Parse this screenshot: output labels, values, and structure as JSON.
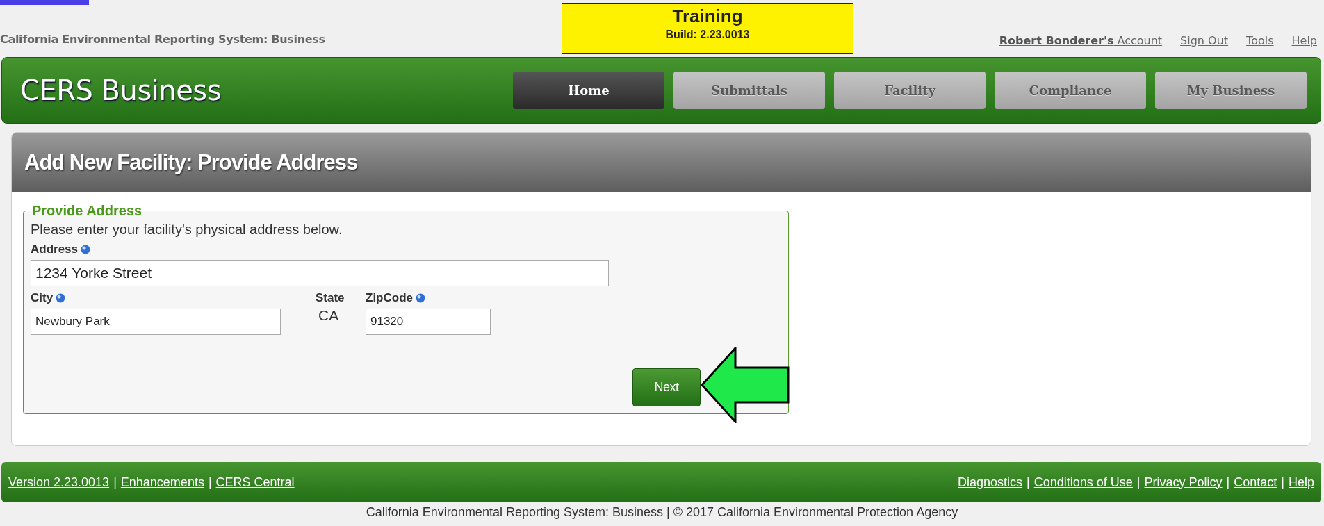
{
  "header": {
    "system_title": "California Environmental Reporting System: Business",
    "environment": {
      "name": "Training",
      "build": "Build: 2.23.0013"
    },
    "account": {
      "user": "Robert Bonderer's",
      "label": "Account"
    },
    "links": [
      "Sign Out",
      "Tools",
      "Help"
    ]
  },
  "app_bar": {
    "title": "CERS Business",
    "tabs": [
      {
        "label": "Home",
        "selected": true,
        "disabled": false
      },
      {
        "label": "Submittals",
        "selected": false,
        "disabled": true
      },
      {
        "label": "Facility",
        "selected": false,
        "disabled": true
      },
      {
        "label": "Compliance",
        "selected": false,
        "disabled": true
      },
      {
        "label": "My Business",
        "selected": false,
        "disabled": true
      }
    ]
  },
  "panel": {
    "title": "Add New Facility: Provide Address",
    "legend": "Provide Address",
    "instructions": "Please enter your facility's physical address below.",
    "address": {
      "label": "Address",
      "help": true,
      "value": "1234 Yorke Street"
    },
    "row": [
      {
        "kind": "input",
        "label": "City",
        "help": true,
        "value": "Newbury Park"
      },
      {
        "kind": "static",
        "label": "State",
        "help": false,
        "value": "CA"
      },
      {
        "kind": "input",
        "label": "ZipCode",
        "help": true,
        "value": "91320"
      }
    ],
    "buttons": [
      {
        "kind": "primary",
        "label": "Next"
      }
    ],
    "annotation": {
      "kind": "arrow"
    }
  },
  "footer": {
    "left_links": [
      {
        "kind": "link",
        "text": "Version 2.23.0013"
      },
      {
        "kind": "separator",
        "text": "|"
      },
      {
        "kind": "link",
        "text": "Enhancements"
      },
      {
        "kind": "separator",
        "text": "|"
      },
      {
        "kind": "link",
        "text": "CERS Central"
      }
    ],
    "right_links": [
      {
        "kind": "link",
        "text": "Diagnostics"
      },
      {
        "kind": "separator",
        "text": "|"
      },
      {
        "kind": "link",
        "text": "Conditions of Use"
      },
      {
        "kind": "separator",
        "text": "|"
      },
      {
        "kind": "link",
        "text": "Privacy Policy"
      },
      {
        "kind": "separator",
        "text": "|"
      },
      {
        "kind": "link",
        "text": "Contact"
      },
      {
        "kind": "separator",
        "text": "|"
      },
      {
        "kind": "link",
        "text": "Help"
      }
    ],
    "copyright": "California Environmental Reporting System: Business | © 2017 California Environmental Protection Agency"
  }
}
